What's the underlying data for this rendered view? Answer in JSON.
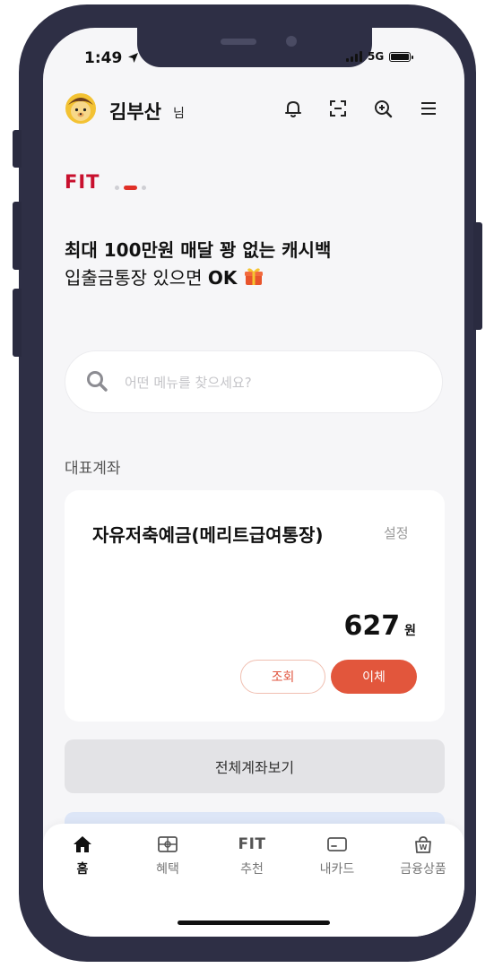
{
  "status_bar": {
    "time": "1:49",
    "network": "5G"
  },
  "header": {
    "user_name": "김부산",
    "user_suffix": "님"
  },
  "brand": "FIT",
  "promo": {
    "line1": "최대 100만원 매달 꽝 없는 캐시백",
    "line2_prefix": "입출금통장 있으면 ",
    "line2_strong": "OK"
  },
  "search": {
    "placeholder": "어떤 메뉴를 찾으세요?"
  },
  "section": {
    "title": "대표계좌"
  },
  "account": {
    "name": "자유저축예금(메리트급여통장)",
    "setting_label": "설정",
    "balance": "627",
    "currency": "원",
    "inquiry_label": "조회",
    "transfer_label": "이체"
  },
  "all_accounts_label": "전체계좌보기",
  "bottom_nav": {
    "items": [
      {
        "label": "홈",
        "icon": "home-icon",
        "active": true
      },
      {
        "label": "혜택",
        "icon": "benefit-icon"
      },
      {
        "label": "추천",
        "icon": "fit-icon",
        "icon_text": "FIT"
      },
      {
        "label": "내카드",
        "icon": "card-icon"
      },
      {
        "label": "금융상품",
        "icon": "financial-product-icon"
      }
    ]
  },
  "colors": {
    "accent": "#e2563c",
    "brand_red": "#c8102e",
    "frame": "#2e2f45"
  }
}
